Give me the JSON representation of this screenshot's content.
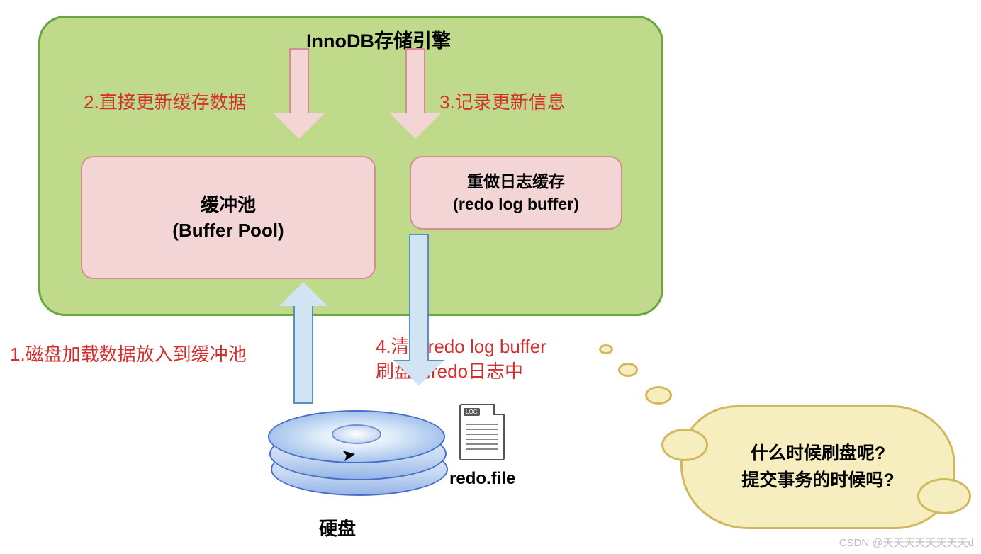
{
  "engine_title": "InnoDB存储引擎",
  "steps": {
    "s1": "1.磁盘加载数据放入到缓冲池",
    "s2": "2.直接更新缓存数据",
    "s3": "3.记录更新信息",
    "s4_l1": "4.清空redo log buffer",
    "s4_l2": "刷盘到redo日志中"
  },
  "buffer_pool": {
    "line1": "缓冲池",
    "line2": "(Buffer Pool)"
  },
  "redo_buffer": {
    "line1": "重做日志缓存",
    "line2": "(redo log buffer)"
  },
  "disk_label": "硬盘",
  "redo_file_label": "redo.file",
  "file_tag": "LOG",
  "thought": {
    "line1": "什么时候刷盘呢?",
    "line2": "提交事务的时候吗?"
  },
  "watermark": "CSDN @天天天天天天天天d",
  "colors": {
    "green_bg": "#c0da8c",
    "green_border": "#6aa53e",
    "pink_bg": "#f4d5d5",
    "pink_border": "#d18f8f",
    "blue_border": "#5a8fc2",
    "red_text": "#d32f2f",
    "cloud_bg": "#f7eec0",
    "cloud_border": "#d1b85e"
  }
}
